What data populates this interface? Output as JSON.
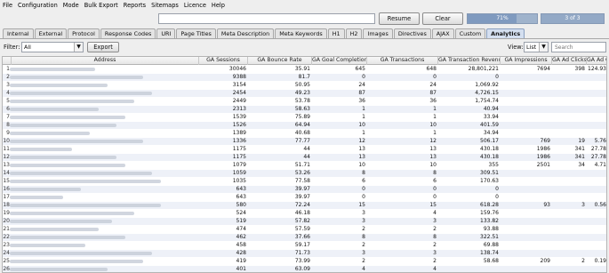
{
  "menu": [
    "File",
    "Configuration",
    "Mode",
    "Bulk Export",
    "Reports",
    "Sitemaps",
    "Licence",
    "Help"
  ],
  "toolbar": {
    "resume_label": "Resume",
    "clear_label": "Clear",
    "progress_text": "71%",
    "progress_fraction": 0.71,
    "counter_text": "3 of 3"
  },
  "tabs": [
    {
      "label": "Internal",
      "active": false
    },
    {
      "label": "External",
      "active": false
    },
    {
      "label": "Protocol",
      "active": false
    },
    {
      "label": "Response Codes",
      "active": false
    },
    {
      "label": "URI",
      "active": false
    },
    {
      "label": "Page Titles",
      "active": false
    },
    {
      "label": "Meta Description",
      "active": false
    },
    {
      "label": "Meta Keywords",
      "active": false
    },
    {
      "label": "H1",
      "active": false
    },
    {
      "label": "H2",
      "active": false
    },
    {
      "label": "Images",
      "active": false
    },
    {
      "label": "Directives",
      "active": false
    },
    {
      "label": "AJAX",
      "active": false
    },
    {
      "label": "Custom",
      "active": false
    },
    {
      "label": "Analytics",
      "active": true
    }
  ],
  "filter": {
    "label": "Filter:",
    "value": "All",
    "export_label": "Export",
    "view_label": "View:",
    "view_value": "List",
    "search_placeholder": "Search"
  },
  "table": {
    "columns": [
      "",
      "Address",
      "GA Sessions",
      "GA Bounce Rate",
      "GA Goal Completions All",
      "GA Transactions",
      "GA Transaction Revenue",
      "GA Impressions",
      "GA Ad Clicks",
      "GA Ad Cost"
    ],
    "rows": [
      [
        "1",
        "",
        "30046",
        "35.91",
        "645",
        "648",
        "28,801,221",
        "7694",
        "398",
        "124.93"
      ],
      [
        "2",
        "",
        "9388",
        "81.7",
        "0",
        "0",
        "0",
        "",
        "",
        ""
      ],
      [
        "3",
        "",
        "3154",
        "50.95",
        "24",
        "24",
        "1,069.92",
        "",
        "",
        ""
      ],
      [
        "4",
        "",
        "2454",
        "49.23",
        "87",
        "87",
        "4,726.15",
        "",
        "",
        ""
      ],
      [
        "5",
        "",
        "2449",
        "53.78",
        "36",
        "36",
        "1,754.74",
        "",
        "",
        ""
      ],
      [
        "6",
        "",
        "2313",
        "58.63",
        "1",
        "1",
        "40.94",
        "",
        "",
        ""
      ],
      [
        "7",
        "",
        "1539",
        "75.89",
        "1",
        "1",
        "33.94",
        "",
        "",
        ""
      ],
      [
        "8",
        "",
        "1526",
        "64.94",
        "10",
        "10",
        "401.59",
        "",
        "",
        ""
      ],
      [
        "9",
        "",
        "1389",
        "40.68",
        "1",
        "1",
        "34.94",
        "",
        "",
        ""
      ],
      [
        "10",
        "",
        "1336",
        "77.77",
        "12",
        "12",
        "506.17",
        "769",
        "19",
        "5.76"
      ],
      [
        "11",
        "",
        "1175",
        "44",
        "13",
        "13",
        "430.18",
        "1986",
        "341",
        "27.78"
      ],
      [
        "12",
        "",
        "1175",
        "44",
        "13",
        "13",
        "430.18",
        "1986",
        "341",
        "27.78"
      ],
      [
        "13",
        "",
        "1079",
        "51.71",
        "10",
        "10",
        "355",
        "2501",
        "34",
        "4.71"
      ],
      [
        "14",
        "",
        "1059",
        "53.26",
        "8",
        "8",
        "309.51",
        "",
        "",
        ""
      ],
      [
        "15",
        "",
        "1035",
        "77.58",
        "6",
        "6",
        "170.63",
        "",
        "",
        ""
      ],
      [
        "16",
        "",
        "643",
        "39.97",
        "0",
        "0",
        "0",
        "",
        "",
        ""
      ],
      [
        "17",
        "",
        "643",
        "39.97",
        "0",
        "0",
        "0",
        "",
        "",
        ""
      ],
      [
        "18",
        "",
        "580",
        "72.24",
        "15",
        "15",
        "618.28",
        "93",
        "3",
        "0.56"
      ],
      [
        "19",
        "",
        "524",
        "46.18",
        "3",
        "4",
        "159.76",
        "",
        "",
        ""
      ],
      [
        "20",
        "",
        "519",
        "57.82",
        "3",
        "3",
        "133.82",
        "",
        "",
        ""
      ],
      [
        "21",
        "",
        "474",
        "57.59",
        "2",
        "2",
        "93.88",
        "",
        "",
        ""
      ],
      [
        "22",
        "",
        "462",
        "37.66",
        "8",
        "8",
        "322.51",
        "",
        "",
        ""
      ],
      [
        "23",
        "",
        "458",
        "59.17",
        "2",
        "2",
        "69.88",
        "",
        "",
        ""
      ],
      [
        "24",
        "",
        "428",
        "71.73",
        "3",
        "3",
        "138.74",
        "",
        "",
        ""
      ],
      [
        "25",
        "",
        "419",
        "73.99",
        "2",
        "2",
        "58.68",
        "209",
        "2",
        "0.19"
      ],
      [
        "26",
        "",
        "401",
        "63.09",
        "4",
        "4",
        "",
        "",
        "",
        ""
      ]
    ]
  }
}
